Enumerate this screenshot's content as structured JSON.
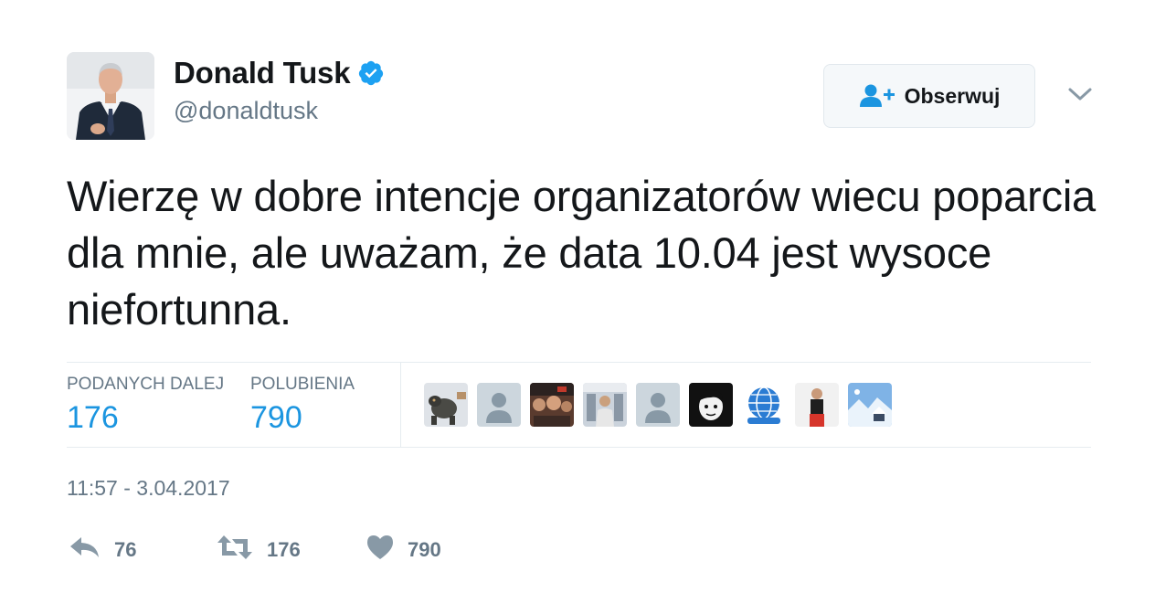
{
  "author": {
    "display_name": "Donald Tusk",
    "handle": "@donaldtusk",
    "verified": true,
    "avatar_icon": "profile-photo"
  },
  "follow_button": {
    "label": "Obserwuj",
    "icon": "follow-user-icon"
  },
  "menu_icon": "chevron-down-icon",
  "tweet": {
    "text": "Wierzę w dobre intencje organizatorów wiecu poparcia dla mnie, ale uważam, że data 10.04 jest wysoce niefortunna."
  },
  "stats": {
    "retweets_label": "PODANYCH DALEJ",
    "retweets_value": "176",
    "likes_label": "POLUBIENIA",
    "likes_value": "790"
  },
  "likers": [
    {
      "icon": "liker-avatar-dog"
    },
    {
      "icon": "liker-avatar-default"
    },
    {
      "icon": "liker-avatar-crowd"
    },
    {
      "icon": "liker-avatar-man-outdoors"
    },
    {
      "icon": "liker-avatar-default"
    },
    {
      "icon": "liker-avatar-face-sketch"
    },
    {
      "icon": "liker-avatar-globe-logo"
    },
    {
      "icon": "liker-avatar-man-red"
    },
    {
      "icon": "liker-avatar-winter-landscape"
    }
  ],
  "timestamp": "11:57 - 3.04.2017",
  "actions": {
    "reply_count": "76",
    "retweet_count": "176",
    "like_count": "790"
  },
  "colors": {
    "accent": "#1b95e0",
    "verified": "#1da1f2",
    "text_primary": "#14171a",
    "text_secondary": "#657786",
    "divider": "#e6ecf0"
  }
}
